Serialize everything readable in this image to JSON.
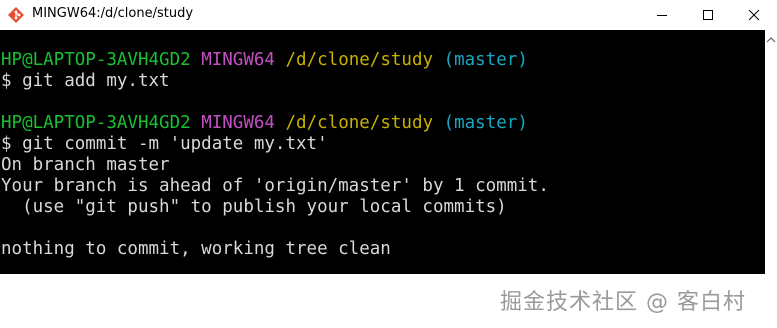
{
  "window": {
    "title": "MINGW64:/d/clone/study",
    "icon": "git-bash-icon",
    "controls": {
      "minimize": "minimize-icon",
      "maximize": "maximize-icon",
      "close": "close-icon"
    }
  },
  "colors": {
    "prompt_user": "#19c033",
    "prompt_shell": "#c450c4",
    "prompt_path": "#c8b000",
    "prompt_branch": "#17a8c4",
    "text": "#d8d8d8",
    "background": "#000000"
  },
  "terminal": {
    "prompt1": {
      "user": "HP@LAPTOP-3AVH4GD2",
      "shell": "MINGW64",
      "path": "/d/clone/study",
      "branch": "(master)"
    },
    "cmd1": "$ git add my.txt",
    "prompt2": {
      "user": "HP@LAPTOP-3AVH4GD2",
      "shell": "MINGW64",
      "path": "/d/clone/study",
      "branch": "(master)"
    },
    "cmd2": "$ git commit -m 'update my.txt'",
    "out1": "On branch master",
    "out2": "Your branch is ahead of 'origin/master' by 1 commit.",
    "out3": "  (use \"git push\" to publish your local commits)",
    "out4": "nothing to commit, working tree clean"
  },
  "watermark": "掘金技术社区 @ 客白村"
}
